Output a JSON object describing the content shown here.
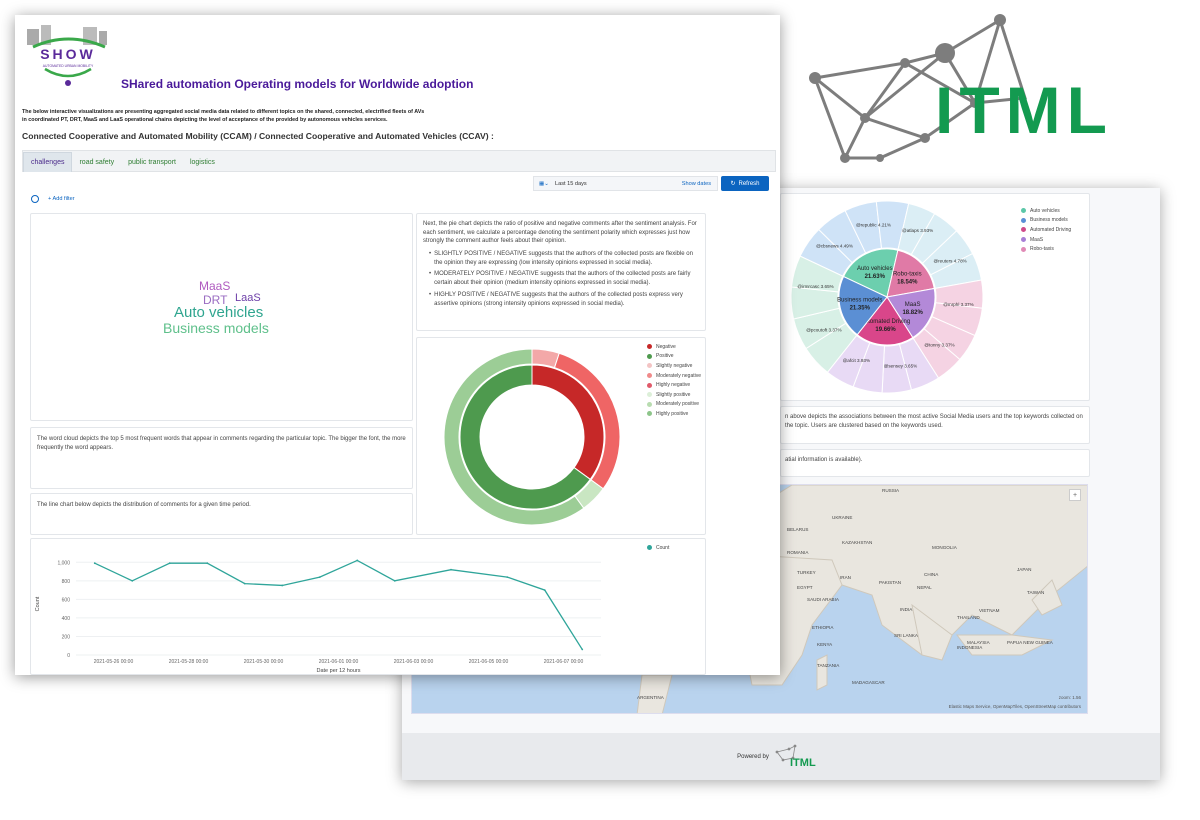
{
  "header": {
    "logo_text": "SHOW",
    "logo_subtitle": "AUTOMATED URBAN MOBILITY",
    "title": "SHared automation Operating models for Worldwide adoption",
    "intro_line1": "The below interactive visualizations are presenting aggregated social media data related to different topics on the shared, connected, electrified fleets of AVs",
    "intro_line2": "in coordinated PT, DRT, MaaS and LaaS operational chains depicting the level of acceptance of the provided by autonomous vehicles services.",
    "section_title": "Connected Cooperative and Automated Mobility (CCAM) / Connected Cooperative and Automated Vehicles (CCAV) :"
  },
  "tabs": [
    "challenges",
    "road safety",
    "public transport",
    "logistics"
  ],
  "toolbar": {
    "time_range": "Last 15 days",
    "show_dates": "Show dates",
    "refresh": "Refresh",
    "add_filter": "+ Add filter"
  },
  "wordcloud": {
    "words": [
      {
        "text": "MaaS",
        "color": "#b05bc0"
      },
      {
        "text": "DRT",
        "color": "#9a6cc2"
      },
      {
        "text": "LaaS",
        "color": "#6d3fa8"
      },
      {
        "text": "Auto vehicles",
        "color": "#2fa58f"
      },
      {
        "text": "Business models",
        "color": "#5fc08b"
      }
    ],
    "description": "The word cloud depicts the top 5 most frequent words that appear in comments regarding the particular topic. The bigger the font, the more frequently the word appears."
  },
  "sentiment_text": {
    "intro": "Next, the pie chart depicts the ratio of positive and negative comments after the sentiment analysis. For each sentiment, we calculate a percentage denoting the sentiment polarity which expresses just how strongly the comment author feels about their opinion.",
    "bullets": [
      "SLIGHTLY POSITIVE / NEGATIVE suggests that the authors of the collected posts are flexible on the opinion they are expressing (low intensity opinions expressed in social media).",
      "MODERATELY POSITIVE / NEGATIVE suggests that the authors of the collected posts are fairly certain about their opinion (medium intensity opinions expressed in social media).",
      "HIGHLY POSITIVE / NEGATIVE suggests that the authors of the collected posts express very assertive opinions (strong intensity opinions expressed in social media)."
    ]
  },
  "line_description": "The line chart below depicts the distribution of comments for a given time period.",
  "colors": {
    "accent": "#0b64c0",
    "teal": "#2fa59a",
    "negative": "#c62828",
    "positive": "#4e9a4e"
  },
  "chart_data": [
    {
      "type": "pie",
      "title": "",
      "legend": [
        {
          "label": "Negative",
          "color": "#c62828"
        },
        {
          "label": "Positive",
          "color": "#4e9a4e"
        },
        {
          "label": "Slightly negative",
          "color": "#f3c4c4"
        },
        {
          "label": "Moderately negative",
          "color": "#f08a8a"
        },
        {
          "label": "Highly negative",
          "color": "#e05a6a"
        },
        {
          "label": "Slightly positive",
          "color": "#dcefd8"
        },
        {
          "label": "Moderately positive",
          "color": "#b8dcb0"
        },
        {
          "label": "Highly positive",
          "color": "#8dc58a"
        }
      ],
      "inner": [
        {
          "label": "Negative",
          "value": 35,
          "color": "#c62828"
        },
        {
          "label": "Positive",
          "value": 65,
          "color": "#4e9a4e"
        }
      ],
      "outer": [
        {
          "label": "Moderately negative",
          "value": 5,
          "color": "#f3a8a8"
        },
        {
          "label": "Highly negative",
          "value": 30,
          "color": "#ef6565"
        },
        {
          "label": "Slightly positive",
          "value": 5,
          "color": "#c9e6c2"
        },
        {
          "label": "Highly positive",
          "value": 60,
          "color": "#9ccd96"
        }
      ]
    },
    {
      "type": "line",
      "xlabel": "Date per 12 hours",
      "ylabel": "Count",
      "ylim": [
        0,
        1100
      ],
      "yticks": [
        "1,000",
        "800",
        "600",
        "400",
        "200",
        "0"
      ],
      "xtick_labels": [
        "2021-05-26 00:00",
        "2021-05-28 00:00",
        "2021-05-30 00:00",
        "2021-06-01 00:00",
        "2021-06-03 00:00",
        "2021-06-05 00:00",
        "2021-06-07 00:00"
      ],
      "series": [
        {
          "name": "Count",
          "color": "#2fa59a",
          "x": [
            "2021-05-25 12:00",
            "2021-05-26 12:00",
            "2021-05-27 12:00",
            "2021-05-28 12:00",
            "2021-05-29 12:00",
            "2021-05-30 12:00",
            "2021-05-31 12:00",
            "2021-06-01 12:00",
            "2021-06-02 12:00",
            "2021-06-04 00:00",
            "2021-06-05 12:00",
            "2021-06-06 12:00",
            "2021-06-07 12:00"
          ],
          "values": [
            990,
            800,
            990,
            990,
            770,
            750,
            840,
            1020,
            800,
            920,
            840,
            700,
            60
          ]
        }
      ]
    },
    {
      "type": "pie",
      "title": "",
      "legend": [
        {
          "label": "Auto vehicles",
          "color": "#5bc7a8"
        },
        {
          "label": "Business models",
          "color": "#5a8fd6"
        },
        {
          "label": "Automated Driving",
          "color": "#cf4a8a"
        },
        {
          "label": "MaaS",
          "color": "#a77ed6"
        },
        {
          "label": "Robo-taxis",
          "color": "#e08ab6"
        }
      ],
      "inner": [
        {
          "label": "Auto vehicles",
          "value": 21.63,
          "color": "#6ccfae"
        },
        {
          "label": "Robo-taxis",
          "value": 18.54,
          "color": "#e07aa6"
        },
        {
          "label": "MaaS",
          "value": 18.82,
          "color": "#b389d8"
        },
        {
          "label": "Automated Driving",
          "value": 19.66,
          "color": "#d9468a"
        },
        {
          "label": "Business models",
          "value": 21.35,
          "color": "#5b8fd4"
        }
      ],
      "outer_labels": [
        "@cbsnews 4.49%",
        "@republic 4.21%",
        "@atlaps 3.93%",
        "@reuters 4.78%",
        "@mrphl 3.37%",
        "@tonny 3.37%",
        "@sensey 3.65%",
        "@afcit 3.93%",
        "@pcoutoft 3.37%",
        "@irmrcasc 3.65%"
      ]
    }
  ],
  "map": {
    "labels": [
      "RUSSIA",
      "KAZAKHSTAN",
      "MONGOLIA",
      "CHINA",
      "IRAN",
      "PAKISTAN",
      "INDIA",
      "NEPAL",
      "EGYPT",
      "SAUDI ARABIA",
      "ETHIOPIA",
      "KENYA",
      "TANZANIA",
      "SRI LANKA",
      "THAILAND",
      "VIETNAM",
      "MALAYSIA",
      "INDONESIA",
      "PAPUA NEW GUINEA",
      "ARGENTINA",
      "TURKEY",
      "ROMANIA",
      "UKRAINE",
      "BELARUS",
      "JAPAN",
      "TAIWAN",
      "MADAGASCAR"
    ],
    "attribution": "Elastic Maps Service, OpenMapTiles, OpenStreetMap contributors",
    "zoom": "zoom: 1.56",
    "description": "n above depicts the associations between the most active Social Media users and the top keywords collected on the topic. Users are clustered based on the keywords used.",
    "geo_note": "atial information is available)."
  },
  "footer": {
    "powered_by": "Powered by",
    "brand": "ITML"
  },
  "brand_logo": "ITML"
}
